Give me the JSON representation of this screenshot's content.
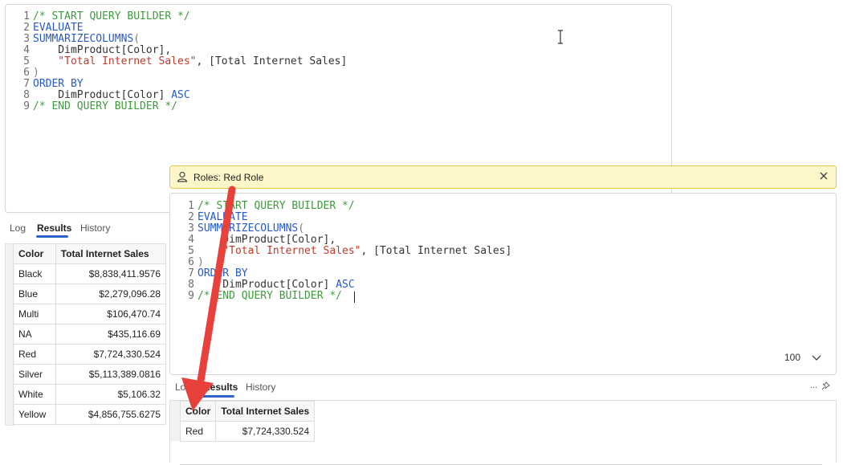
{
  "query": {
    "lines": [
      {
        "num": "1",
        "parts": [
          {
            "cls": "c-com",
            "text": "/* START QUERY BUILDER */"
          }
        ]
      },
      {
        "num": "2",
        "parts": [
          {
            "cls": "c-kw",
            "text": "EVALUATE"
          }
        ]
      },
      {
        "num": "3",
        "parts": [
          {
            "cls": "c-kw",
            "text": "SUMMARIZECOLUMNS"
          },
          {
            "cls": "c-op",
            "text": "("
          }
        ]
      },
      {
        "num": "4",
        "parts": [
          {
            "cls": "c-txt",
            "text": "    DimProduct[Color],"
          }
        ]
      },
      {
        "num": "5",
        "parts": [
          {
            "cls": "c-str",
            "text": "    \"Total Internet Sales\""
          },
          {
            "cls": "c-txt",
            "text": ", [Total Internet Sales]"
          }
        ]
      },
      {
        "num": "6",
        "parts": [
          {
            "cls": "c-op",
            "text": ")"
          }
        ]
      },
      {
        "num": "7",
        "parts": [
          {
            "cls": "c-kw",
            "text": "ORDER BY"
          }
        ]
      },
      {
        "num": "8",
        "parts": [
          {
            "cls": "c-txt",
            "text": "    DimProduct[Color] "
          },
          {
            "cls": "c-kw",
            "text": "ASC"
          }
        ]
      },
      {
        "num": "9",
        "parts": [
          {
            "cls": "c-com",
            "text": "/* END QUERY BUILDER */"
          }
        ]
      }
    ]
  },
  "background": {
    "tabs": {
      "log": "Log",
      "results": "Results",
      "history": "History"
    },
    "table": {
      "headers": [
        "Color",
        "Total Internet Sales"
      ],
      "rows": [
        [
          "Black",
          "$8,838,411.9576"
        ],
        [
          "Blue",
          "$2,279,096.28"
        ],
        [
          "Multi",
          "$106,470.74"
        ],
        [
          "NA",
          "$435,116.69"
        ],
        [
          "Red",
          "$7,724,330.524"
        ],
        [
          "Silver",
          "$5,113,389.0816"
        ],
        [
          "White",
          "$5,106.32"
        ],
        [
          "Yellow",
          "$4,856,755.6275"
        ]
      ]
    }
  },
  "foreground": {
    "role_banner": {
      "label": "Roles: Red Role"
    },
    "zoom": {
      "value": "100"
    },
    "tabs": {
      "log": "Log",
      "results": "Results",
      "history": "History",
      "more": "..."
    },
    "table": {
      "headers": [
        "Color",
        "Total Internet Sales"
      ],
      "rows": [
        [
          "Red",
          "$7,724,330.524"
        ]
      ]
    }
  },
  "colors": {
    "annotation_arrow": "#e8413c",
    "banner_bg": "#fdf6c9",
    "accent": "#2c63c9"
  },
  "icons": [
    "i-beam-cursor-icon",
    "person-icon",
    "close-icon",
    "chevron-down-icon",
    "ellipsis-icon",
    "pin-icon",
    "annotation-arrow"
  ]
}
